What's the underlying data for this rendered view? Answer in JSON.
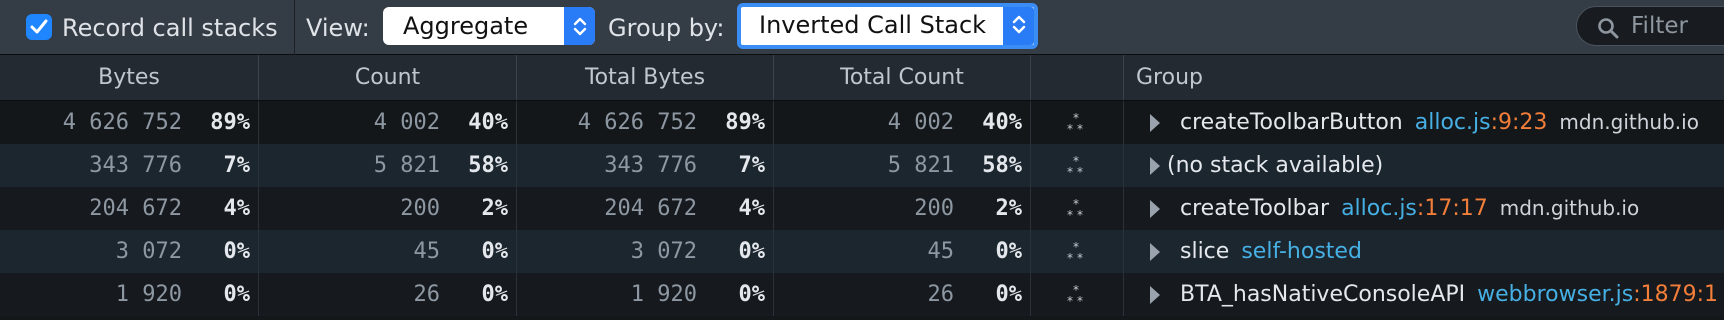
{
  "toolbar": {
    "record_label": "Record call stacks",
    "record_checked": true,
    "view_label": "View:",
    "view_value": "Aggregate",
    "groupby_label": "Group by:",
    "groupby_value": "Inverted Call Stack",
    "filter_placeholder": "Filter"
  },
  "columns": {
    "bytes": "Bytes",
    "count": "Count",
    "total_bytes": "Total Bytes",
    "total_count": "Total Count",
    "group": "Group"
  },
  "rows": [
    {
      "bytes": "4 626 752",
      "bytes_pct": "89%",
      "count": "4 002",
      "count_pct": "40%",
      "total_bytes": "4 626 752",
      "total_bytes_pct": "89%",
      "total_count": "4 002",
      "total_count_pct": "40%",
      "fn": "createToolbarButton",
      "file": "alloc.js",
      "loc": ":9:23",
      "host": "mdn.github.io",
      "plain": ""
    },
    {
      "bytes": "343 776",
      "bytes_pct": "7%",
      "count": "5 821",
      "count_pct": "58%",
      "total_bytes": "343 776",
      "total_bytes_pct": "7%",
      "total_count": "5 821",
      "total_count_pct": "58%",
      "fn": "",
      "file": "",
      "loc": "",
      "host": "",
      "plain": "(no stack available)"
    },
    {
      "bytes": "204 672",
      "bytes_pct": "4%",
      "count": "200",
      "count_pct": "2%",
      "total_bytes": "204 672",
      "total_bytes_pct": "4%",
      "total_count": "200",
      "total_count_pct": "2%",
      "fn": "createToolbar",
      "file": "alloc.js",
      "loc": ":17:17",
      "host": "mdn.github.io",
      "plain": ""
    },
    {
      "bytes": "3 072",
      "bytes_pct": "0%",
      "count": "45",
      "count_pct": "0%",
      "total_bytes": "3 072",
      "total_bytes_pct": "0%",
      "total_count": "45",
      "total_count_pct": "0%",
      "fn": "slice",
      "file": "self-hosted",
      "loc": "",
      "host": "",
      "plain": ""
    },
    {
      "bytes": "1 920",
      "bytes_pct": "0%",
      "count": "26",
      "count_pct": "0%",
      "total_bytes": "1 920",
      "total_bytes_pct": "0%",
      "total_count": "26",
      "total_count_pct": "0%",
      "fn": "BTA_hasNativeConsoleAPI",
      "file": "webbrowser.js",
      "loc": ":1879:1",
      "host": "",
      "plain": ""
    }
  ],
  "icons": {
    "checkbox": "checkmark-icon",
    "select_arrow": "up-down-chevron-icon",
    "filter": "search-icon",
    "row_action": "stars-icon",
    "twisty": "expand-triangle-icon"
  },
  "colors": {
    "accent": "#1f86ff",
    "file": "#46afe3",
    "location": "#f27e3a"
  }
}
